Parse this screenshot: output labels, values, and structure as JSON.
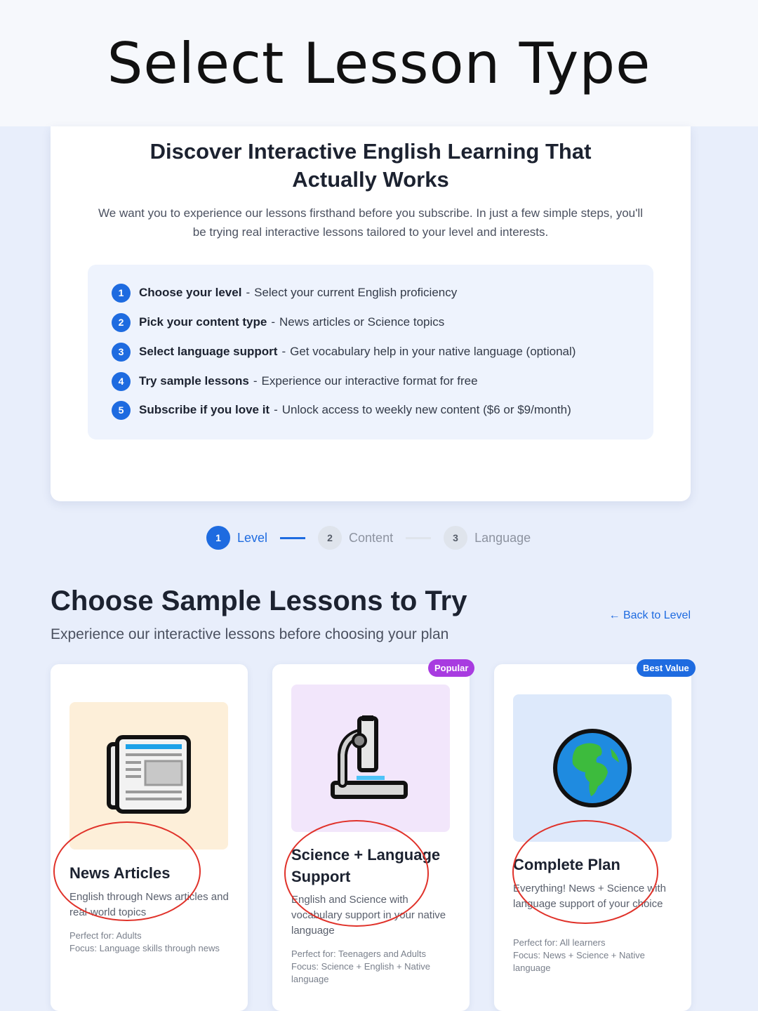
{
  "banner": {
    "title": "Select Lesson Type"
  },
  "intro": {
    "title": "Discover Interactive English Learning That Actually Works",
    "description": "We want you to experience our lessons firsthand before you subscribe. In just a few simple steps, you'll be trying real interactive lessons tailored to your level and interests.",
    "steps": [
      {
        "num": "1",
        "title": "Choose your level",
        "text": "Select your current English proficiency"
      },
      {
        "num": "2",
        "title": "Pick your content type",
        "text": "News articles or Science topics"
      },
      {
        "num": "3",
        "title": "Select language support",
        "text": "Get vocabulary help in your native language (optional)"
      },
      {
        "num": "4",
        "title": "Try sample lessons",
        "text": "Experience our interactive format for free"
      },
      {
        "num": "5",
        "title": "Subscribe if you love it",
        "text": "Unlock access to weekly new content ($6 or $9/month)"
      }
    ],
    "separator": "-"
  },
  "progress": {
    "steps": [
      {
        "num": "1",
        "label": "Level",
        "state": "active"
      },
      {
        "num": "2",
        "label": "Content",
        "state": "inactive"
      },
      {
        "num": "3",
        "label": "Language",
        "state": "inactive"
      }
    ]
  },
  "section": {
    "title": "Choose Sample Lessons to Try",
    "subtitle": "Experience our interactive lessons before choosing your plan",
    "back_link": "← Back to Level"
  },
  "cards": [
    {
      "icon": "newspaper-icon",
      "title": "News Articles",
      "description": "English through News articles and real-world topics",
      "perfect_for": "Perfect for: Adults",
      "focus": "Focus: Language skills through news",
      "illus_bg": "#fdefd9"
    },
    {
      "icon": "microscope-icon",
      "title": "Science + Language Support",
      "description": "English and Science with vocabulary support in your native language",
      "perfect_for": "Perfect for: Teenagers and Adults",
      "focus": "Focus: Science + English + Native language",
      "illus_bg": "#f2e6fb",
      "badge": "Popular",
      "badge_color": "#a83be0"
    },
    {
      "icon": "globe-icon",
      "title": "Complete Plan",
      "description": "Everything! News + Science with language support of your choice",
      "perfect_for": "Perfect for: All learners",
      "focus": "Focus: News + Science + Native language",
      "illus_bg": "#dde9fb",
      "badge": "Best Value",
      "badge_color": "#1e6be0"
    }
  ],
  "colors": {
    "accent": "#1e6be0",
    "annotation_red": "#e0322a",
    "popular": "#a83be0"
  }
}
